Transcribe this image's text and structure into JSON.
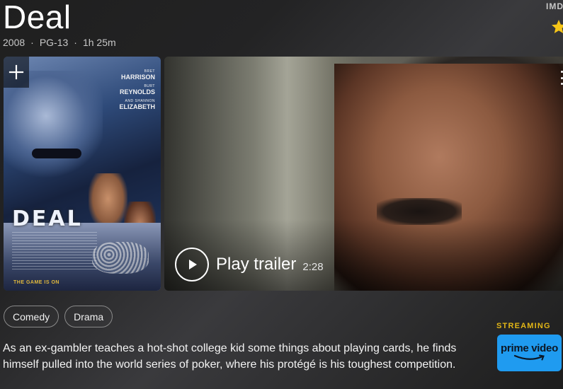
{
  "movie": {
    "title": "Deal",
    "year": "2008",
    "rating": "PG-13",
    "runtime": "1h 25m",
    "separator": "·"
  },
  "imdb": {
    "label": "IMDb",
    "star_color": "#f5c518"
  },
  "poster": {
    "add_icon": "plus-icon",
    "cast": [
      {
        "first": "BRET",
        "last": "HARRISON"
      },
      {
        "first": "BURT",
        "last": "REYNOLDS"
      },
      {
        "first": "AND SHANNON",
        "last": "ELIZABETH"
      }
    ],
    "logo": "DEAL",
    "tagline": "THE GAME IS ON"
  },
  "trailer": {
    "play_label": "Play trailer",
    "duration": "2:28",
    "play_icon": "play-icon",
    "menu_icon": "more-vertical-icon"
  },
  "genres": [
    "Comedy",
    "Drama"
  ],
  "plot": "As an ex-gambler teaches a hot-shot college kid some things about playing cards, he finds himself pulled into the world series of poker, where his protégé is his toughest competition.",
  "streaming": {
    "label": "STREAMING",
    "provider": "prime video",
    "provider_color": "#1f9bf0",
    "label_color": "#e2b616"
  }
}
